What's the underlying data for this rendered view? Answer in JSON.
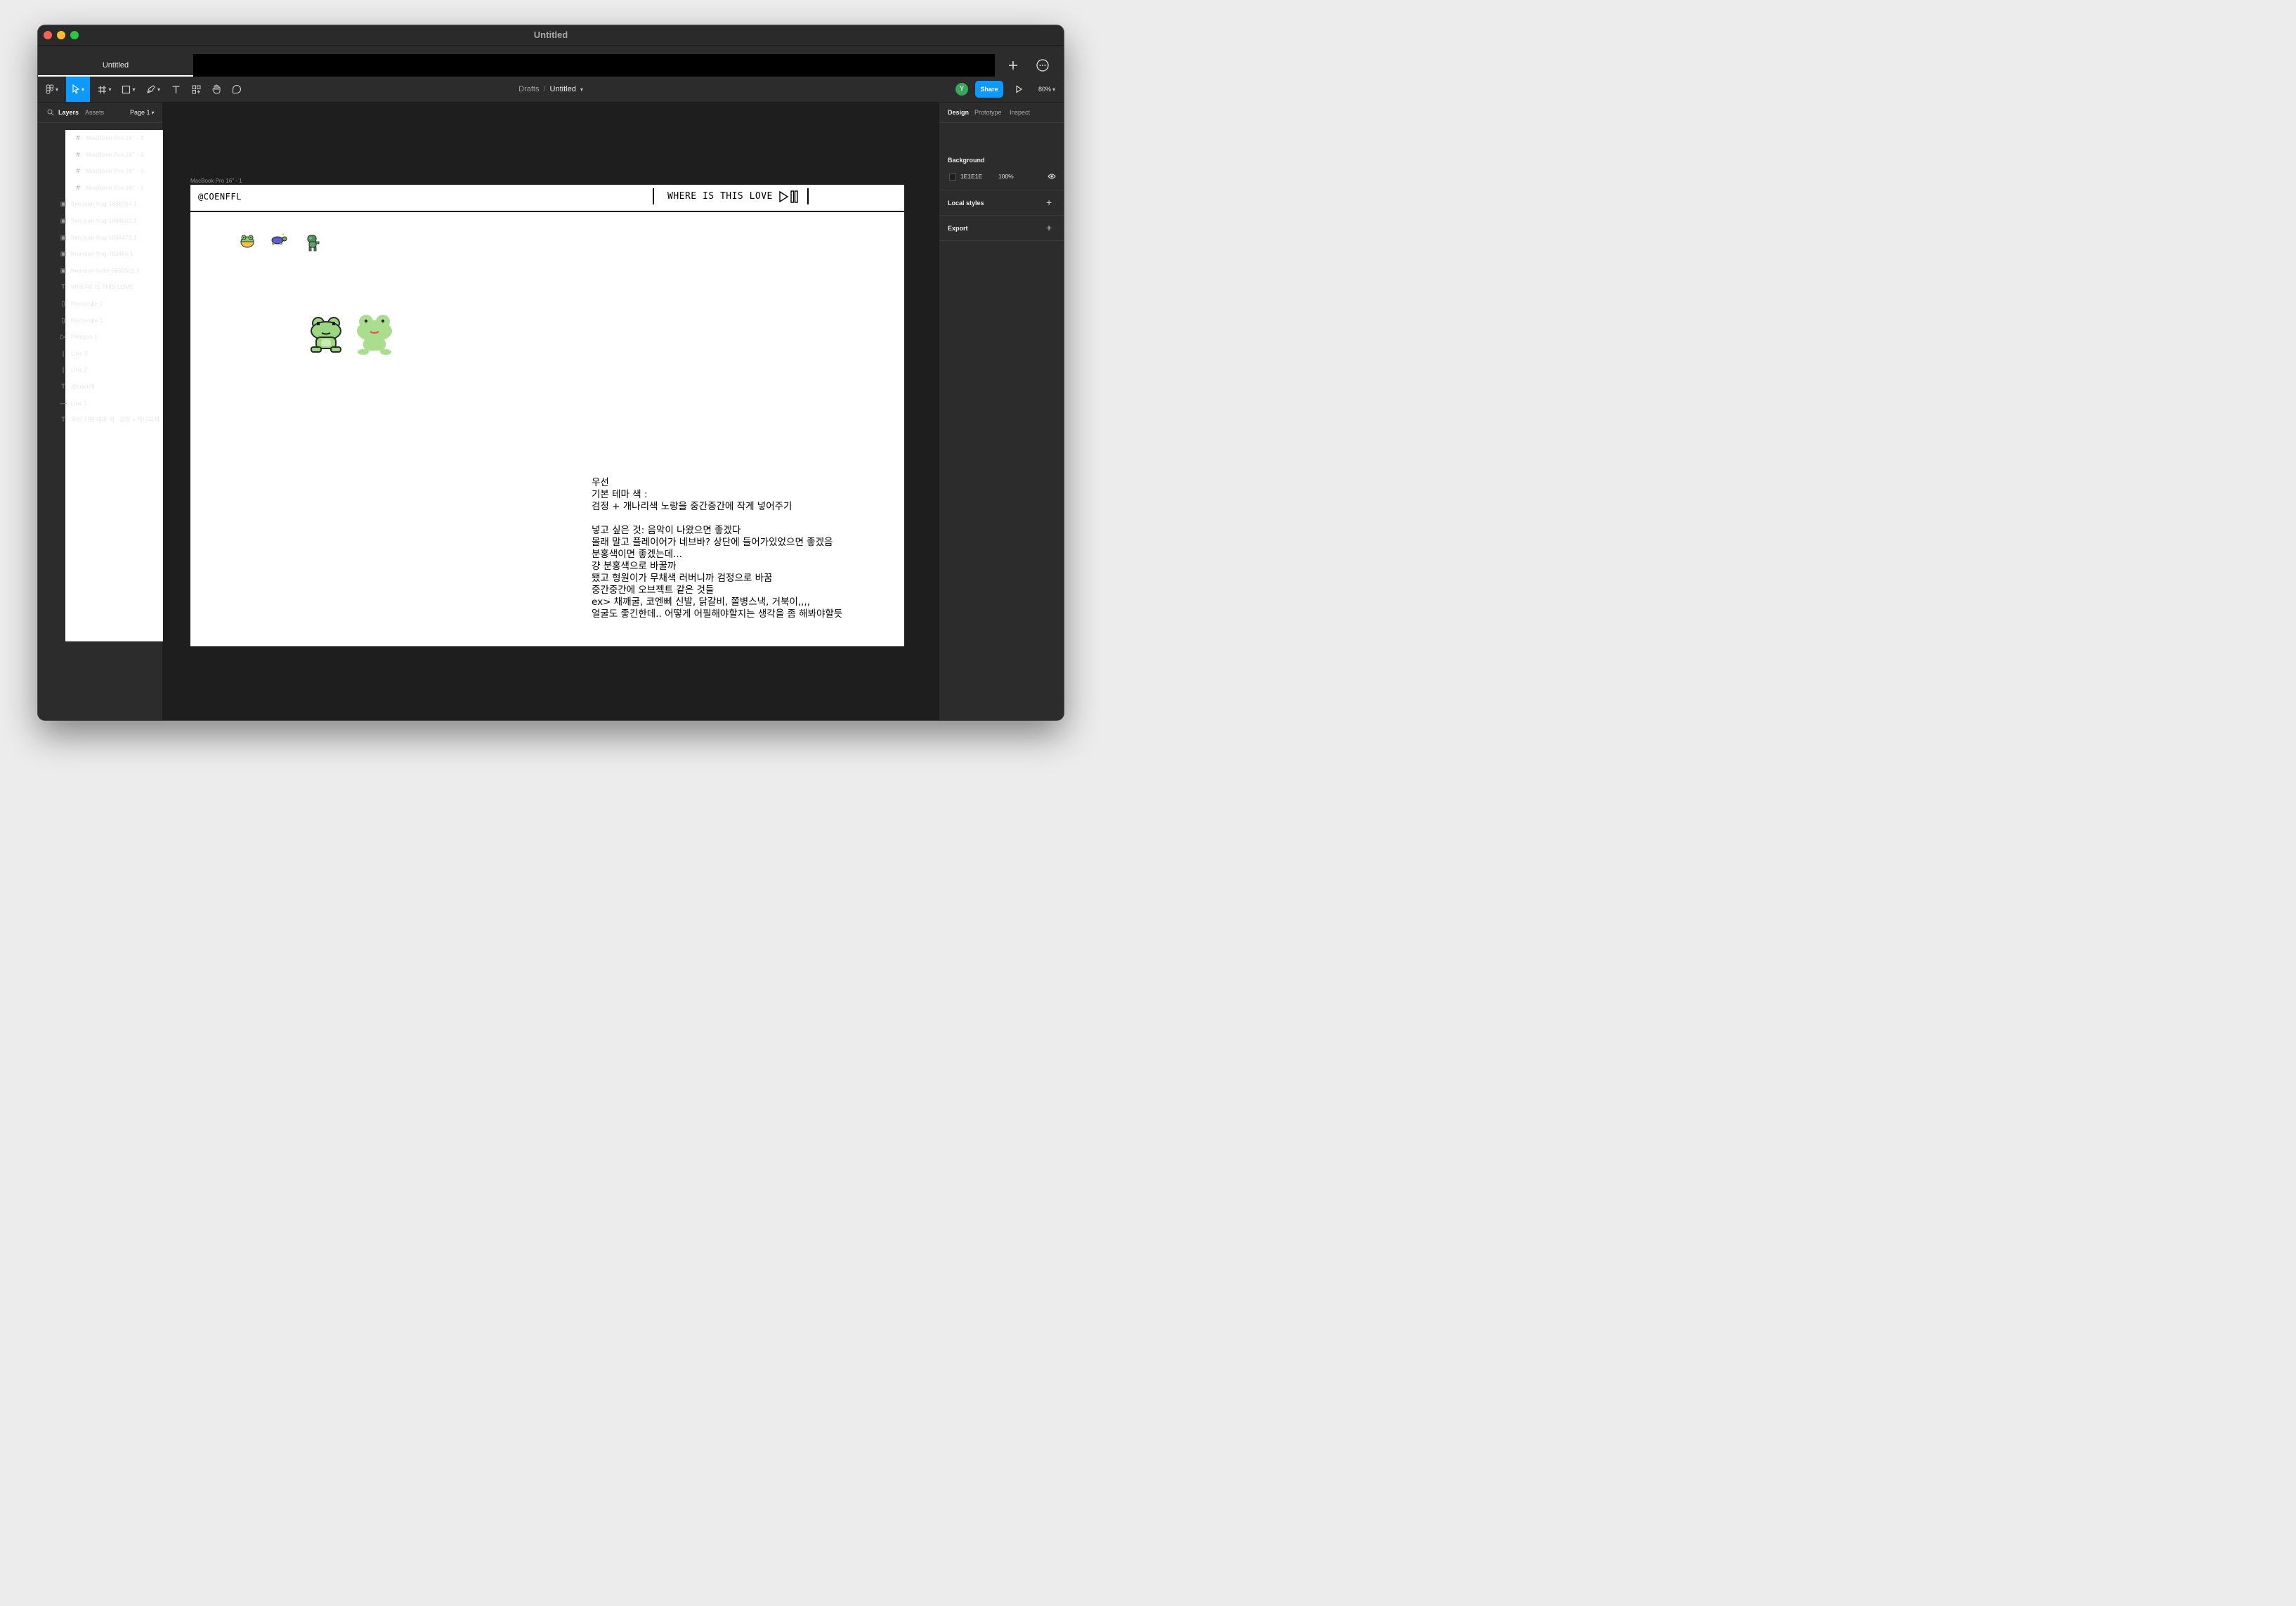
{
  "window": {
    "title": "Untitled"
  },
  "tab": {
    "label": "Untitled"
  },
  "toolbar": {
    "breadcrumb_root": "Drafts",
    "breadcrumb_sep": "/",
    "file_name": "Untitled",
    "avatar_initial": "Y",
    "share_label": "Share",
    "zoom": "80%"
  },
  "layers_panel": {
    "tab_layers": "Layers",
    "tab_assets": "Assets",
    "page": "Page 1",
    "items": [
      {
        "name": "MacBook Pro 16\" - 3",
        "type": "frame"
      },
      {
        "name": "MacBook Pro 16\" - 4",
        "type": "frame"
      },
      {
        "name": "MacBook Pro 16\" - 2",
        "type": "frame"
      },
      {
        "name": "MacBook Pro 16\" - 1",
        "type": "frame"
      },
      {
        "name": "free-icon-frog-1838764 1",
        "type": "image"
      },
      {
        "name": "free-icon-frog-1864502 1",
        "type": "image"
      },
      {
        "name": "free-icon-frog-1864472 1",
        "type": "image"
      },
      {
        "name": "free-icon-frog-789465 1",
        "type": "image"
      },
      {
        "name": "free-icon-turtle-6660501 1",
        "type": "image"
      },
      {
        "name": "WHERE IS THIS LOVE",
        "type": "text"
      },
      {
        "name": "Rectangle 2",
        "type": "rect"
      },
      {
        "name": "Rectangle 1",
        "type": "rect"
      },
      {
        "name": "Polygon 1",
        "type": "polygon"
      },
      {
        "name": "Line 3",
        "type": "vline"
      },
      {
        "name": "Line 2",
        "type": "vline"
      },
      {
        "name": "@coenffl",
        "type": "text"
      },
      {
        "name": "Line 1",
        "type": "hline"
      },
      {
        "name": "우선 기본 테마 색 : 검정 + 개나리색...",
        "type": "text"
      }
    ]
  },
  "design_panel": {
    "tab_design": "Design",
    "tab_prototype": "Prototype",
    "tab_inspect": "Inspect",
    "background_title": "Background",
    "background_hex": "1E1E1E",
    "background_opacity": "100%",
    "local_styles": "Local styles",
    "export": "Export"
  },
  "canvas": {
    "frame_label": "MacBook Pro 16\" - 1",
    "handle": "@COENFFL",
    "song_title": "WHERE IS THIS LOVE",
    "note": "우선\n기본 테마 색 :\n검정 + 개나리색 노랑을 중간중간에 작게 넣어주기\n\n넣고 싶은 것: 음악이 나왔으면 좋겠다\n몰래 말고 플레이어가 네브바? 상단에 들어가있었으면 좋겠음\n분홍색이면 좋겠는데...\n걍 분홍색으로 바꿀까\n됐고 형원이가 무채색 러버니까 검정으로 바꿈\n중간중간에 오브젝트 같은 것들\nex> 채깨굴, 코엔삐 신발, 닭갈비, 쫄병스낵, 거북이,,,,\n얼굴도 좋긴한데.. 어떻게 어필해야할지는 생각을 좀 해봐야할듯"
  },
  "colors": {
    "accent": "#0d99ff",
    "canvas_bg": "#1e1e1e",
    "panel_bg": "#2c2c2c",
    "frog_green": "#9ad77f"
  }
}
